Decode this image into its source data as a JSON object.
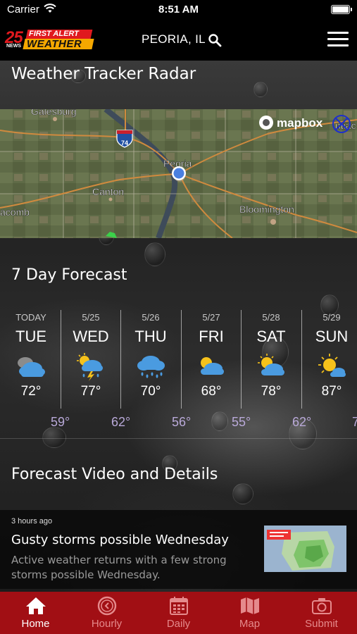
{
  "status_bar": {
    "carrier": "Carrier",
    "time": "8:51 AM"
  },
  "header": {
    "logo": {
      "number": "25",
      "news": "NEWS",
      "line1": "FIRST ALERT",
      "line2": "WEATHER"
    },
    "location": "PEORIA, IL"
  },
  "radar": {
    "title": "Weather Tracker Radar",
    "map_brand": "mapbox",
    "map_labels": {
      "galesburg": "Galesburg",
      "highway": "74",
      "peoria": "Peoria",
      "canton": "Canton",
      "macomb": "acomb",
      "bloomington": "Bloomington",
      "pontiac": "ntiac"
    }
  },
  "forecast": {
    "title": "7 Day Forecast",
    "days": [
      {
        "date": "TODAY",
        "dow": "TUE",
        "icon": "partly-cloudy-dark-icon",
        "high": "72°",
        "low": "59°"
      },
      {
        "date": "5/25",
        "dow": "WED",
        "icon": "thunderstorm-sun-icon",
        "high": "77°",
        "low": "62°"
      },
      {
        "date": "5/26",
        "dow": "THU",
        "icon": "rain-cloud-icon",
        "high": "70°",
        "low": "56°"
      },
      {
        "date": "5/27",
        "dow": "FRI",
        "icon": "partly-sunny-icon",
        "high": "68°",
        "low": "55°"
      },
      {
        "date": "5/28",
        "dow": "SAT",
        "icon": "partly-sunny-icon",
        "high": "78°",
        "low": "62°"
      },
      {
        "date": "5/29",
        "dow": "SUN",
        "icon": "mostly-sunny-icon",
        "high": "87°",
        "low": "7"
      }
    ]
  },
  "video": {
    "title": "Forecast Video and Details",
    "article": {
      "time_ago": "3 hours ago",
      "headline": "Gusty storms possible Wednesday",
      "summary": "Active weather returns with a few strong storms possible Wednesday."
    }
  },
  "tabs": [
    {
      "label": "Home",
      "icon": "home-icon",
      "active": true
    },
    {
      "label": "Hourly",
      "icon": "clock-icon",
      "active": false
    },
    {
      "label": "Daily",
      "icon": "calendar-icon",
      "active": false
    },
    {
      "label": "Map",
      "icon": "map-icon",
      "active": false
    },
    {
      "label": "Submit",
      "icon": "camera-icon",
      "active": false
    }
  ],
  "colors": {
    "brand_red": "#a10f14",
    "logo_red": "#e0191e",
    "logo_gold": "#f5a800",
    "low_temp": "#b9a9d9"
  }
}
